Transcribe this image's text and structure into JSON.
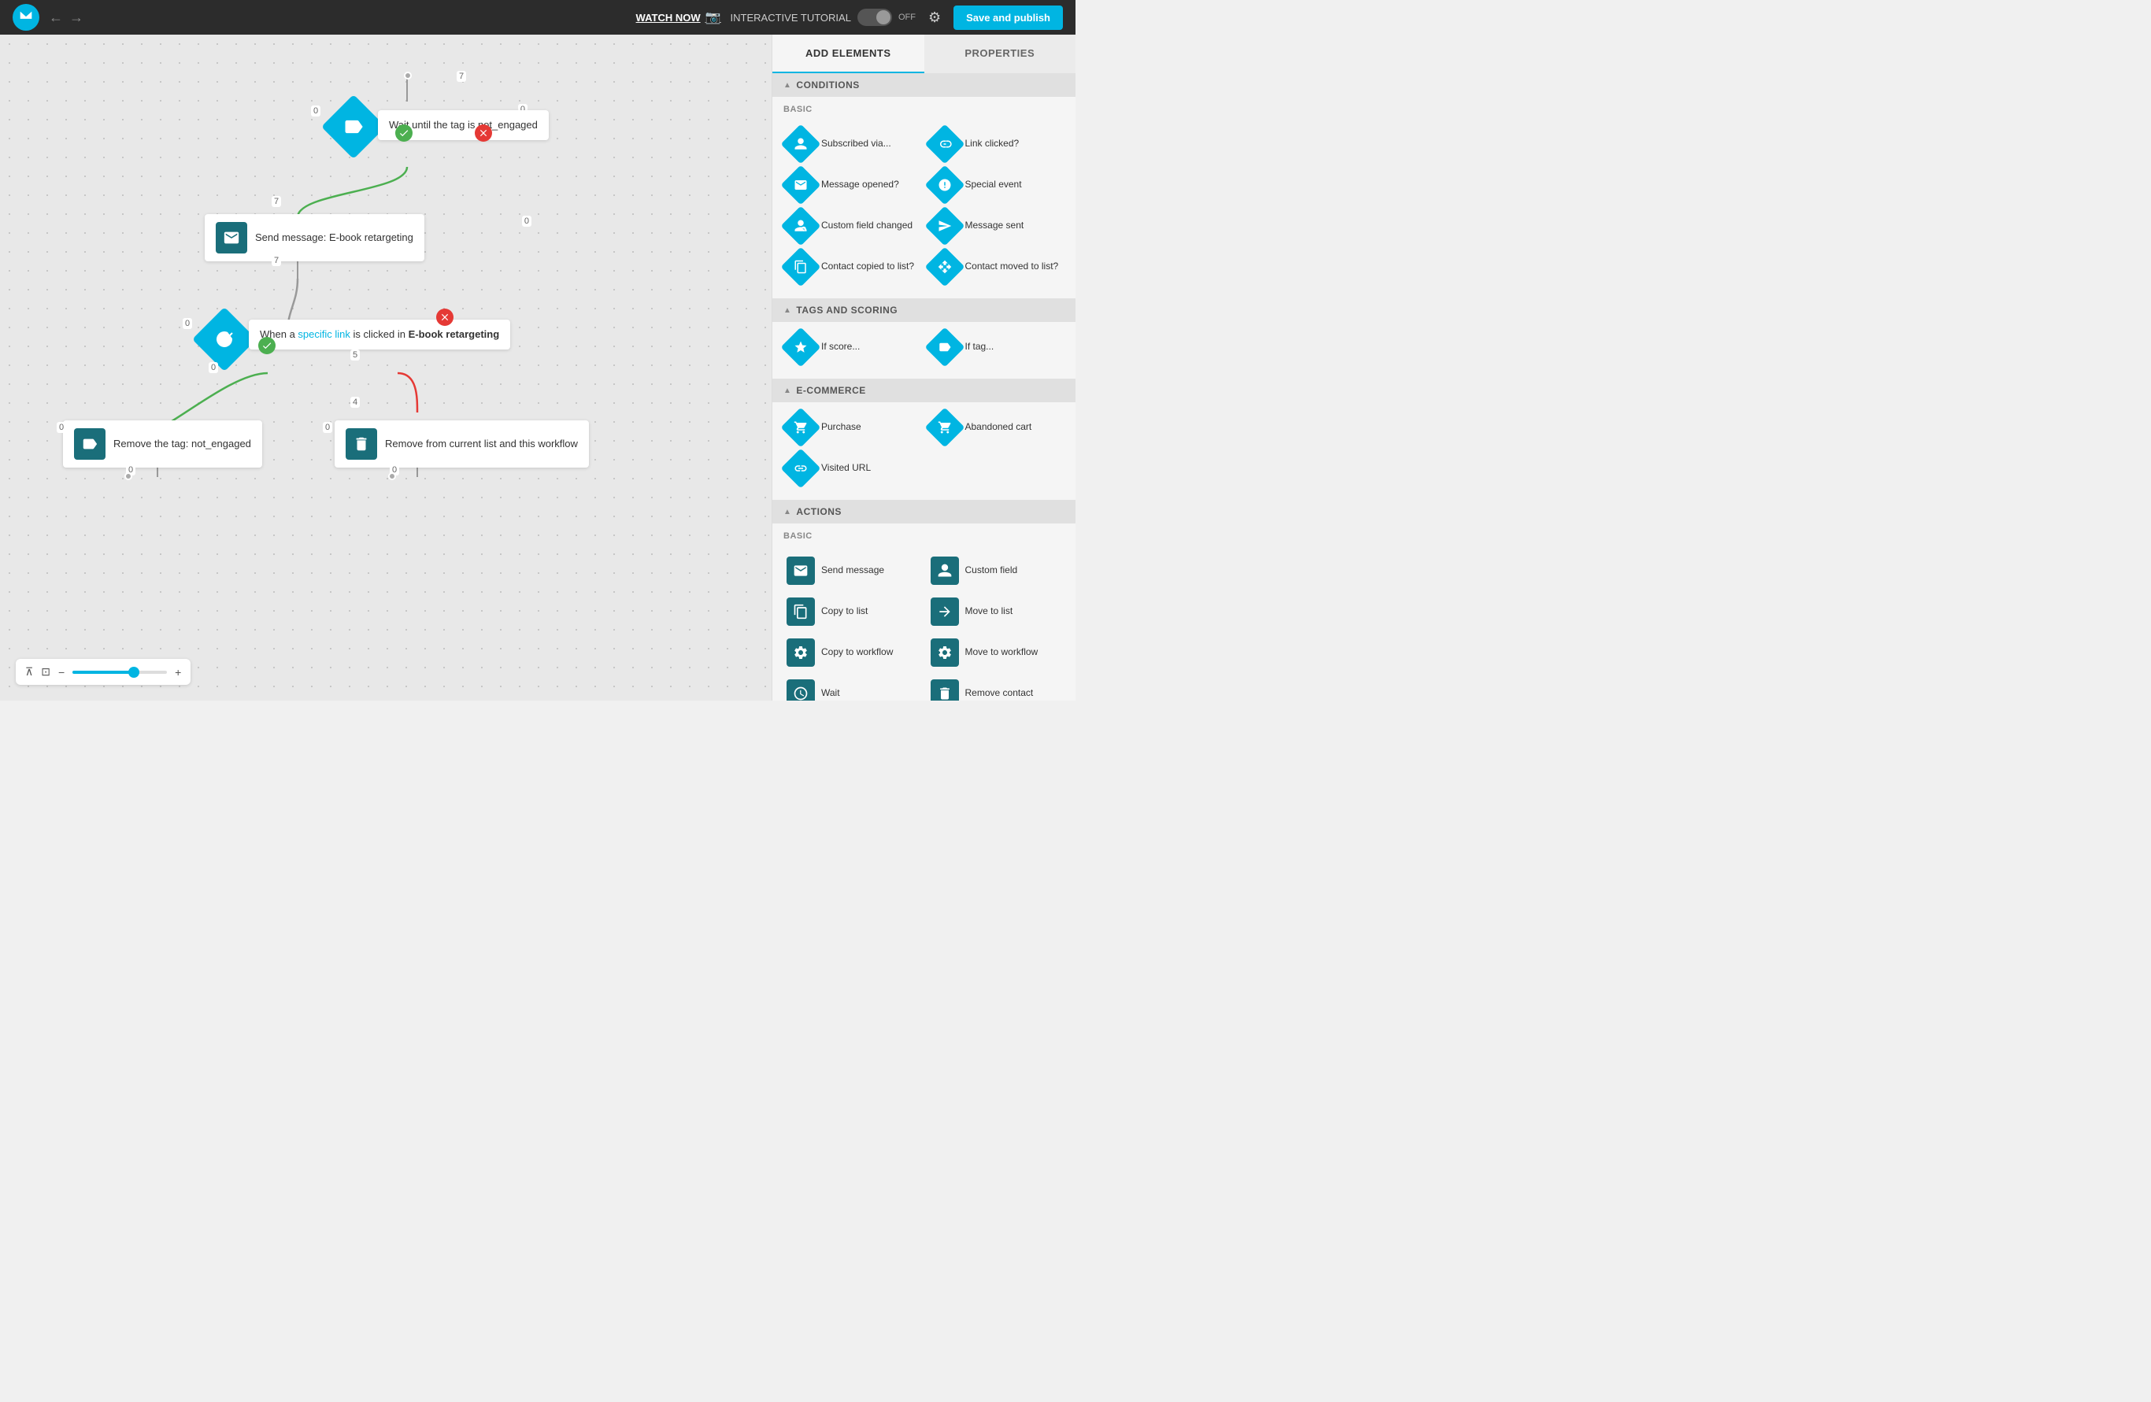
{
  "topnav": {
    "watch_now": "WATCH NOW",
    "interactive_tutorial": "INTERACTIVE TUTORIAL",
    "toggle_state": "OFF",
    "save_publish": "Save and publish"
  },
  "panel": {
    "tab_add": "ADD ELEMENTS",
    "tab_properties": "PROPERTIES",
    "conditions_label": "CONDITIONS",
    "basic_label": "BASIC",
    "tags_scoring_label": "TAGS AND SCORING",
    "ecommerce_label": "E-COMMERCE",
    "actions_label": "ACTIONS",
    "actions_basic_label": "BASIC",
    "conditions_items": [
      {
        "label": "Subscribed via...",
        "icon": "user-icon"
      },
      {
        "label": "Link clicked?",
        "icon": "cursor-icon"
      },
      {
        "label": "Message opened?",
        "icon": "envelope-icon"
      },
      {
        "label": "Special event",
        "icon": "cake-icon"
      },
      {
        "label": "Custom field changed",
        "icon": "user-edit-icon"
      },
      {
        "label": "Message sent",
        "icon": "envelope-send-icon"
      },
      {
        "label": "Contact copied to list?",
        "icon": "copy-icon"
      },
      {
        "label": "Contact moved to list?",
        "icon": "move-icon"
      }
    ],
    "tags_items": [
      {
        "label": "If score...",
        "icon": "star-icon"
      },
      {
        "label": "If tag...",
        "icon": "tag-icon"
      }
    ],
    "ecommerce_items": [
      {
        "label": "Purchase",
        "icon": "cart-icon"
      },
      {
        "label": "Abandoned cart",
        "icon": "cart-x-icon"
      },
      {
        "label": "Visited URL",
        "icon": "link-icon"
      }
    ],
    "actions_items": [
      {
        "label": "Send message",
        "icon": "envelope-dark"
      },
      {
        "label": "Custom field",
        "icon": "user-dark"
      },
      {
        "label": "Copy to list",
        "icon": "copy-dark"
      },
      {
        "label": "Move to list",
        "icon": "move-dark"
      },
      {
        "label": "Copy to workflow",
        "icon": "workflow-copy-dark"
      },
      {
        "label": "Move to workflow",
        "icon": "workflow-move-dark"
      },
      {
        "label": "Wait",
        "icon": "wait-dark"
      },
      {
        "label": "Remove contact",
        "icon": "remove-dark"
      }
    ]
  },
  "nodes": {
    "wait_tag": "Wait until the tag is not_engaged",
    "send_message": "Send message: E-book retargeting",
    "condition_link": "When a specific link is clicked in E-book retargeting",
    "remove_tag": "Remove the tag: not_engaged",
    "remove_list": "Remove from current list and this workflow"
  },
  "zoom": {
    "level": "65%"
  },
  "badges": {
    "b1": "7",
    "b2": "0",
    "b3": "0",
    "b4": "7",
    "b5": "7",
    "b6": "0",
    "b7": "0",
    "b8": "5",
    "b9": "4",
    "b10": "0",
    "b11": "0"
  }
}
